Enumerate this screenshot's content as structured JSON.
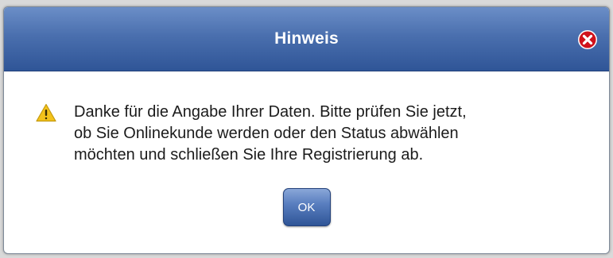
{
  "dialog": {
    "title": "Hinweis",
    "close_icon": "close-icon",
    "warning_icon": "warning-icon",
    "message_lines": [
      "Danke für die Angabe Ihrer Daten. Bitte prüfen Sie jetzt,",
      "ob Sie Onlinekunde werden oder den Status abwählen",
      "möchten und schließen Sie Ihre Registrierung ab."
    ],
    "ok_label": "OK"
  },
  "colors": {
    "titlebar": "#3d639f",
    "title_text": "#ffffff",
    "close_red": "#d0121b",
    "warning_yellow": "#f3c21b",
    "button": "#4a6fae"
  }
}
